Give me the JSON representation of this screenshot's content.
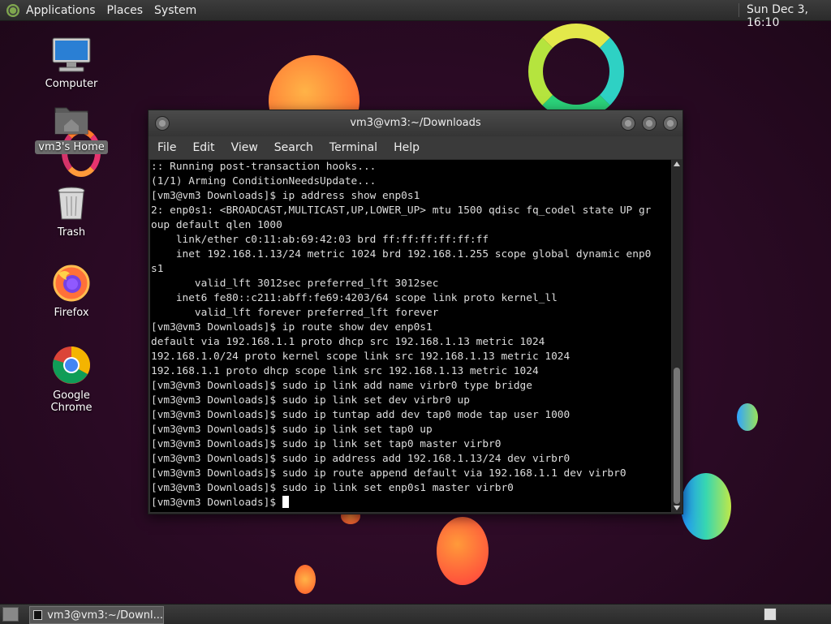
{
  "top_panel": {
    "menus": [
      "Applications",
      "Places",
      "System"
    ],
    "clock": "Sun Dec 3, 16:10"
  },
  "desktop_icons": [
    {
      "label": "Computer",
      "icon": "computer-icon"
    },
    {
      "label": "vm3's Home",
      "icon": "home-folder-icon"
    },
    {
      "label": "Trash",
      "icon": "trash-icon"
    },
    {
      "label": "Firefox",
      "icon": "firefox-icon"
    },
    {
      "label": "Google Chrome",
      "icon": "chrome-icon"
    }
  ],
  "terminal": {
    "title": "vm3@vm3:~/Downloads",
    "menu": [
      "File",
      "Edit",
      "View",
      "Search",
      "Terminal",
      "Help"
    ],
    "lines": [
      ":: Running post-transaction hooks...",
      "(1/1) Arming ConditionNeedsUpdate...",
      "[vm3@vm3 Downloads]$ ip address show enp0s1",
      "2: enp0s1: <BROADCAST,MULTICAST,UP,LOWER_UP> mtu 1500 qdisc fq_codel state UP gr",
      "oup default qlen 1000",
      "    link/ether c0:11:ab:69:42:03 brd ff:ff:ff:ff:ff:ff",
      "    inet 192.168.1.13/24 metric 1024 brd 192.168.1.255 scope global dynamic enp0",
      "s1",
      "       valid_lft 3012sec preferred_lft 3012sec",
      "    inet6 fe80::c211:abff:fe69:4203/64 scope link proto kernel_ll",
      "       valid_lft forever preferred_lft forever",
      "[vm3@vm3 Downloads]$ ip route show dev enp0s1",
      "default via 192.168.1.1 proto dhcp src 192.168.1.13 metric 1024",
      "192.168.1.0/24 proto kernel scope link src 192.168.1.13 metric 1024",
      "192.168.1.1 proto dhcp scope link src 192.168.1.13 metric 1024",
      "[vm3@vm3 Downloads]$ sudo ip link add name virbr0 type bridge",
      "[vm3@vm3 Downloads]$ sudo ip link set dev virbr0 up",
      "[vm3@vm3 Downloads]$ sudo ip tuntap add dev tap0 mode tap user 1000",
      "[vm3@vm3 Downloads]$ sudo ip link set tap0 up",
      "[vm3@vm3 Downloads]$ sudo ip link set tap0 master virbr0",
      "[vm3@vm3 Downloads]$ sudo ip address add 192.168.1.13/24 dev virbr0",
      "[vm3@vm3 Downloads]$ sudo ip route append default via 192.168.1.1 dev virbr0",
      "[vm3@vm3 Downloads]$ sudo ip link set enp0s1 master virbr0"
    ],
    "prompt": "[vm3@vm3 Downloads]$ "
  },
  "taskbar": {
    "task_label": "vm3@vm3:~/Downl..."
  }
}
